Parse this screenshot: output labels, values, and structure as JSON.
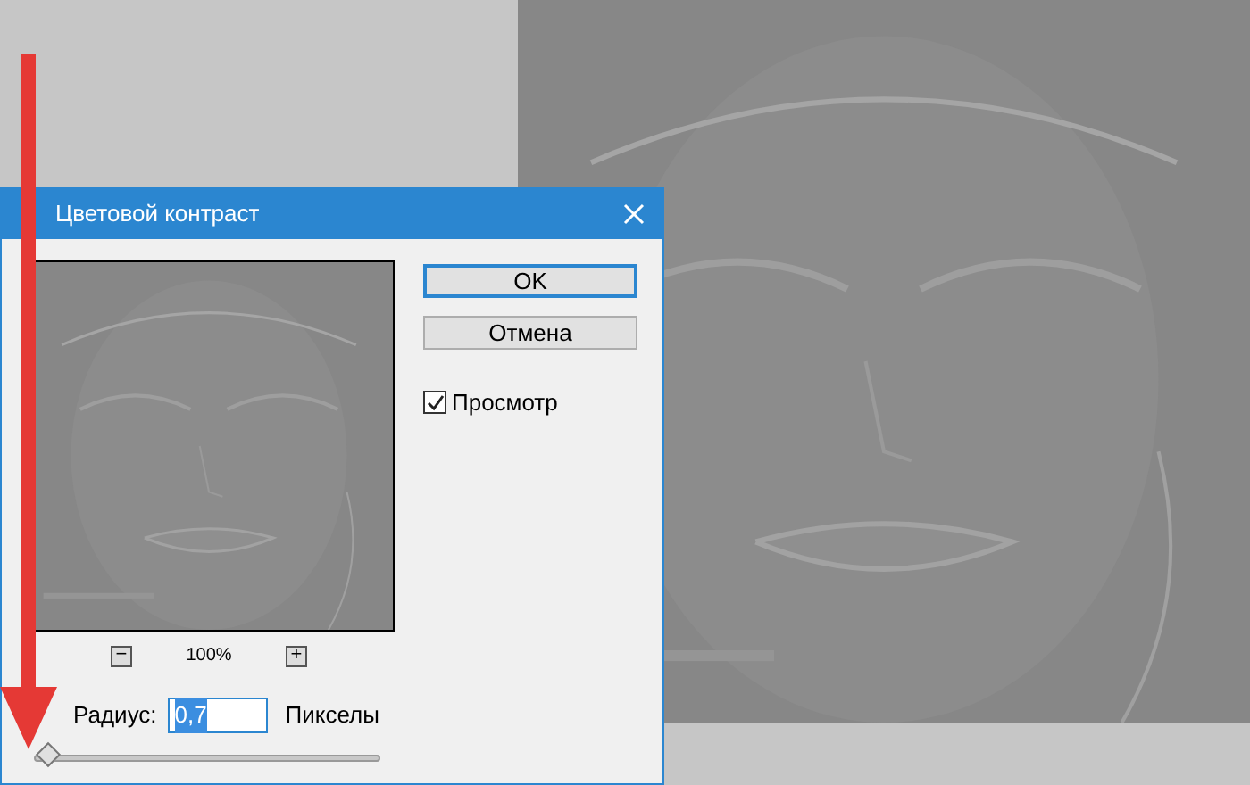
{
  "dialog": {
    "title": "Цветовой контраст",
    "preview": {
      "kind": "picture",
      "zoom_out": "−",
      "zoom": "100%",
      "zoom_in": "+"
    },
    "buttons": [
      {
        "label": "OK",
        "selected": true
      },
      {
        "label": "Отмена",
        "selected": false
      }
    ],
    "preview_checkbox": {
      "label": "Просмотр",
      "checked": true
    },
    "radius": {
      "label": "Радиус:",
      "value": "0,7",
      "unit": "Пикселы",
      "level": 0.02
    }
  }
}
